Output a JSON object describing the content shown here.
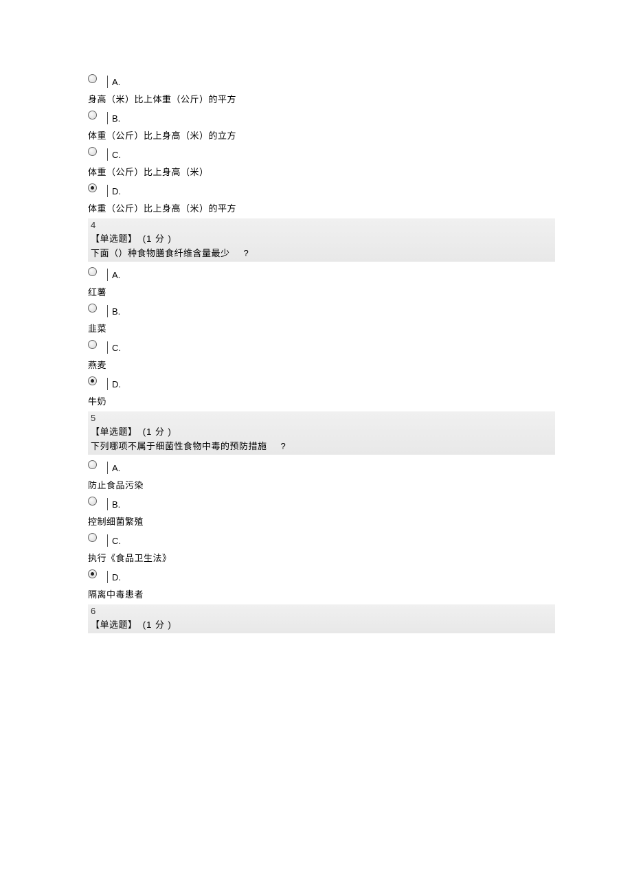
{
  "labels": {
    "question_type": "【单选题】",
    "points": "(1  分 )"
  },
  "q3": {
    "options": [
      {
        "letter": "A.",
        "text": "身高（米）比上体重（公斤）的平方",
        "selected": false
      },
      {
        "letter": "B.",
        "text": "体重（公斤）比上身高（米）的立方",
        "selected": false
      },
      {
        "letter": "C.",
        "text": "体重（公斤）比上身高（米）",
        "selected": false
      },
      {
        "letter": "D.",
        "text": "体重（公斤）比上身高（米）的平方",
        "selected": true
      }
    ]
  },
  "q4": {
    "number": "4",
    "text": "下面（）种食物膳食纤维含量最少",
    "qmark": "?",
    "options": [
      {
        "letter": "A.",
        "text": "红薯",
        "selected": false
      },
      {
        "letter": "B.",
        "text": "韭菜",
        "selected": false
      },
      {
        "letter": "C.",
        "text": "燕麦",
        "selected": false
      },
      {
        "letter": "D.",
        "text": "牛奶",
        "selected": true
      }
    ]
  },
  "q5": {
    "number": "5",
    "text": "下列哪项不属于细菌性食物中毒的预防措施",
    "qmark": "?",
    "options": [
      {
        "letter": "A.",
        "text": "防止食品污染",
        "selected": false
      },
      {
        "letter": "B.",
        "text": "控制细菌繁殖",
        "selected": false
      },
      {
        "letter": "C.",
        "text": "执行《食品卫生法》",
        "selected": false
      },
      {
        "letter": "D.",
        "text": "隔离中毒患者",
        "selected": true
      }
    ]
  },
  "q6": {
    "number": "6"
  }
}
